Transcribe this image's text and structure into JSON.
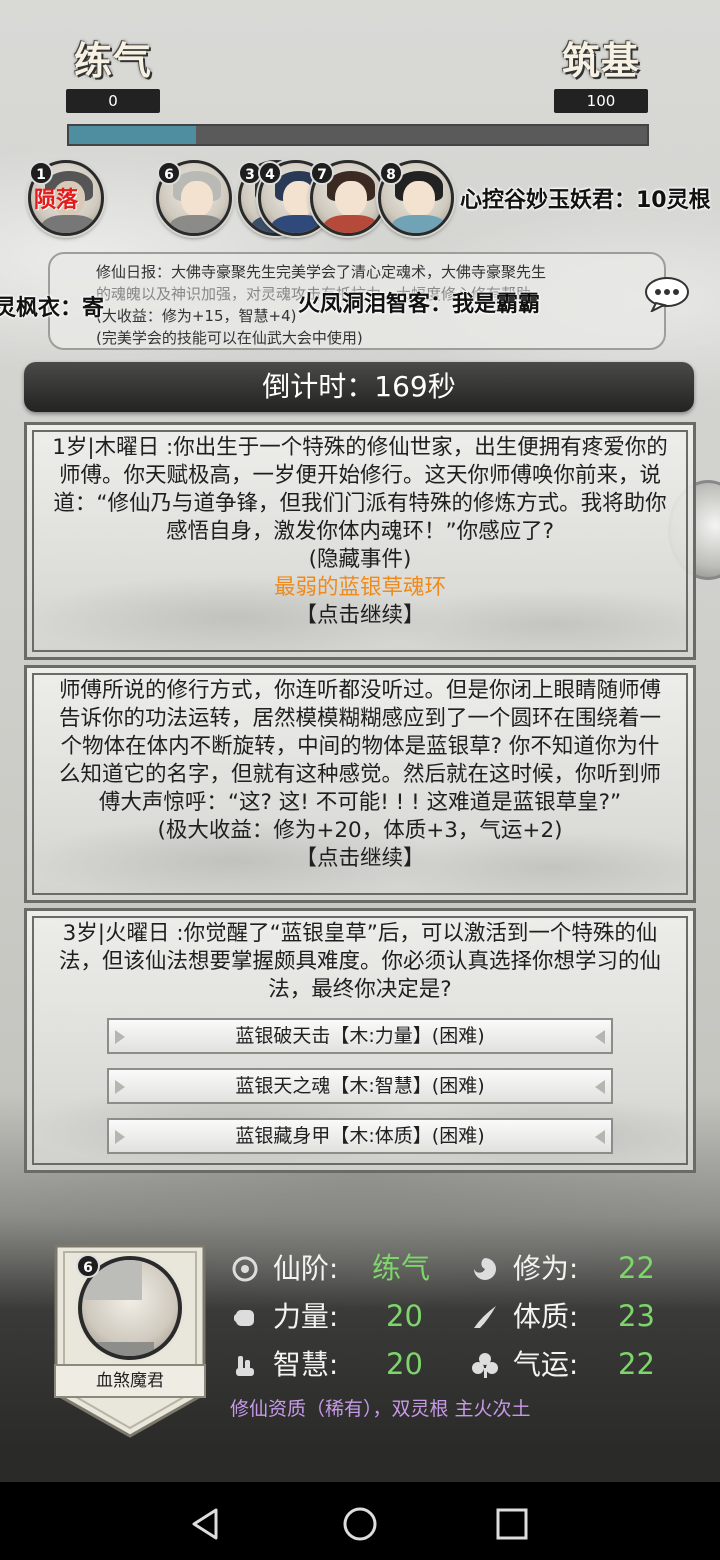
{
  "realm": {
    "current_name": "练气",
    "current_value": "0",
    "next_name": "筑基",
    "next_value": "100",
    "progress_fraction": 0.22
  },
  "players": {
    "avatars": [
      {
        "badge": "1",
        "status": "陨落"
      },
      {
        "badge": "6"
      },
      {
        "badge": "3"
      },
      {
        "badge": "4"
      },
      {
        "badge": "7"
      },
      {
        "badge": "8"
      }
    ],
    "marquee_right": "心控谷妙玉妖君：10灵根",
    "marquee_left_fragment": "灵枫衣：寄",
    "marquee_mid": "火凤洞泪智客：我是霸霸"
  },
  "report": {
    "line1": "修仙日报：大佛寺豪聚先生完美学会了清心定魂术，大佛寺豪聚先生",
    "line2": "的魂魄以及神识加强，对灵魂攻击有抵抗力，大幅度修心修有帮助",
    "line3": "(大收益：修为+15，智慧+4)",
    "line4": "(完美学会的技能可以在仙武大会中使用)"
  },
  "countdown": "倒计时：169秒",
  "events": [
    {
      "text": "1岁|木曜日 :你出生于一个特殊的修仙世家，出生便拥有疼爱你的师傅。你天赋极高，一岁便开始修行。这天你师傅唤你前来，说道：“修仙乃与道争锋，但我们门派有特殊的修炼方式。我将助你感悟自身，激发你体内魂环！”你感应了?",
      "tag": "(隐藏事件)",
      "result": "最弱的蓝银草魂环",
      "continue": "【点击继续】"
    },
    {
      "text": "师傅所说的修行方式，你连听都没听过。但是你闭上眼睛随师傅告诉你的功法运转，居然模模糊糊感应到了一个圆环在围绕着一个物体在体内不断旋转，中间的物体是蓝银草? 你不知道你为什么知道它的名字，但就有这种感觉。然后就在这时候，你听到师傅大声惊呼：“这? 这! 不可能! ! ! 这难道是蓝银草皇?”",
      "gain": "(极大收益：修为+20，体质+3，气运+2)",
      "continue": "【点击继续】"
    },
    {
      "text": "3岁|火曜日 :你觉醒了“蓝银皇草”后，可以激活到一个特殊的仙法，但该仙法想要掌握颇具难度。你必须认真选择你想学习的仙法，最终你决定是?",
      "options": [
        "蓝银破天击【木:力量】(困难)",
        "蓝银天之魂【木:智慧】(困难)",
        "蓝银藏身甲【木:体质】(困难)"
      ]
    }
  ],
  "character": {
    "badge": "6",
    "name": "血煞魔君",
    "stats": {
      "realm_label": "仙阶:",
      "realm_value": "练气",
      "cultivation_label": "修为:",
      "cultivation_value": "22",
      "strength_label": "力量:",
      "strength_value": "20",
      "constitution_label": "体质:",
      "constitution_value": "23",
      "wisdom_label": "智慧:",
      "wisdom_value": "20",
      "luck_label": "气运:",
      "luck_value": "22"
    },
    "aptitude": "修仙资质（稀有），双灵根 主火次土"
  },
  "colors": {
    "progress": "#4f8ea0",
    "highlight": "#f08a1a",
    "stat_value": "#7dd66a",
    "aptitude": "#c79ae8",
    "fallen": "#e21b1b"
  },
  "icons": [
    "chat-bubble-icon",
    "realm-icon",
    "cultivation-icon",
    "strength-icon",
    "constitution-icon",
    "wisdom-icon",
    "luck-icon",
    "back-icon",
    "home-icon",
    "recents-icon"
  ]
}
